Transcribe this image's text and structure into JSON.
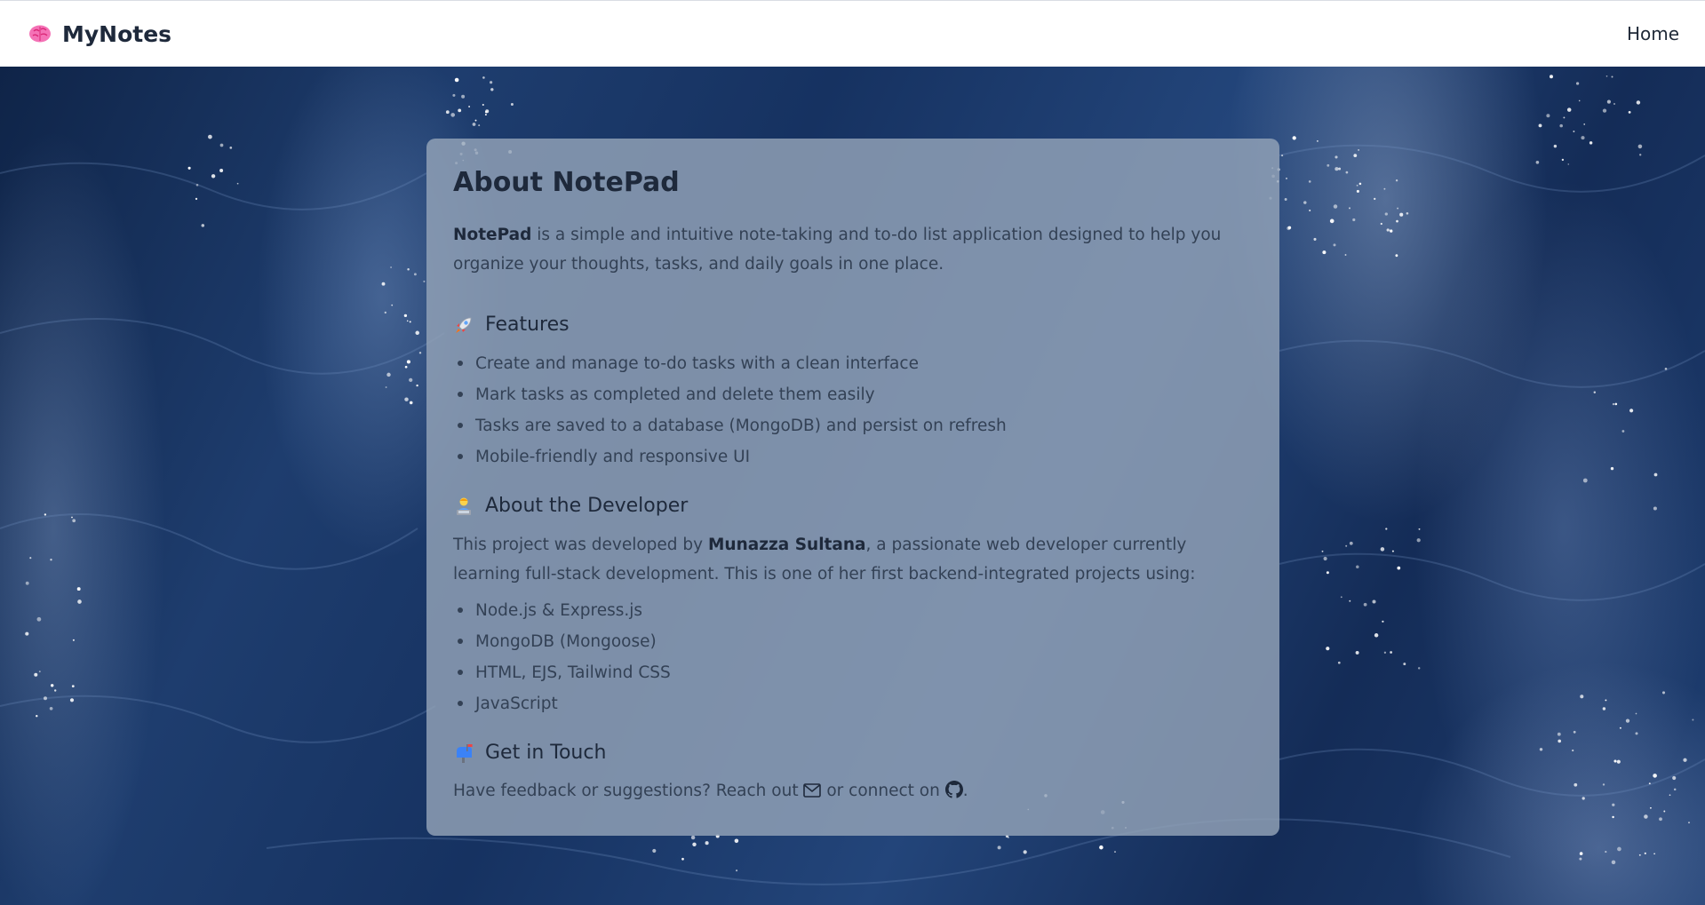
{
  "navbar": {
    "brand_name": "MyNotes",
    "brand_icon": "brain-icon",
    "home_link": "Home"
  },
  "about": {
    "title": "About NotePad",
    "intro_app_name": "NotePad",
    "intro_text": " is a simple and intuitive note-taking and to-do list application designed to help you organize your thoughts, tasks, and daily goals in one place.",
    "features": {
      "icon": "rocket-icon",
      "heading": "Features",
      "items": [
        "Create and manage to-do tasks with a clean interface",
        "Mark tasks as completed and delete them easily",
        "Tasks are saved to a database (MongoDB) and persist on refresh",
        "Mobile-friendly and responsive UI"
      ]
    },
    "developer": {
      "icon": "developer-icon",
      "heading": "About the Developer",
      "text_before": "This project was developed by ",
      "name": "Munazza Sultana",
      "text_after": ", a passionate web developer currently learning full-stack development. This is one of her first backend-integrated projects using:",
      "stack": [
        "Node.js & Express.js",
        "MongoDB (Mongoose)",
        "HTML, EJS, Tailwind CSS",
        "JavaScript"
      ]
    },
    "contact": {
      "icon": "mailbox-icon",
      "heading": "Get in Touch",
      "text_before": "Have feedback or suggestions? Reach out ",
      "text_middle": " or connect on ",
      "text_after": ".",
      "email_icon": "envelope-icon",
      "github_icon": "github-icon"
    }
  },
  "colors": {
    "navbar_bg": "#ffffff",
    "card_bg": "#94a3b8",
    "heading": "#1e293b",
    "body_text": "#334155"
  }
}
